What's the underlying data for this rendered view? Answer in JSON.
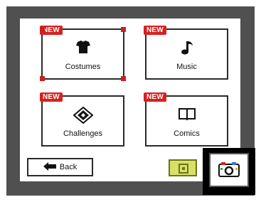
{
  "menu": {
    "tiles": [
      {
        "label": "Costumes",
        "badge": "NEW",
        "icon": "shirt-icon",
        "selected": true
      },
      {
        "label": "Music",
        "badge": "NEW",
        "icon": "music-note-icon",
        "selected": false
      },
      {
        "label": "Challenges",
        "badge": "NEW",
        "icon": "diamond-emblem-icon",
        "selected": false
      },
      {
        "label": "Comics",
        "badge": "NEW",
        "icon": "book-icon",
        "selected": false
      }
    ]
  },
  "footer": {
    "back_label": "Back",
    "yellow_button_icon": "target-icon",
    "camera_button_icon": "camera-icon"
  },
  "colors": {
    "frame": "#505050",
    "badge": "#d8201f",
    "selection": "#c8201e",
    "yellow_button": "#d8e06a"
  }
}
